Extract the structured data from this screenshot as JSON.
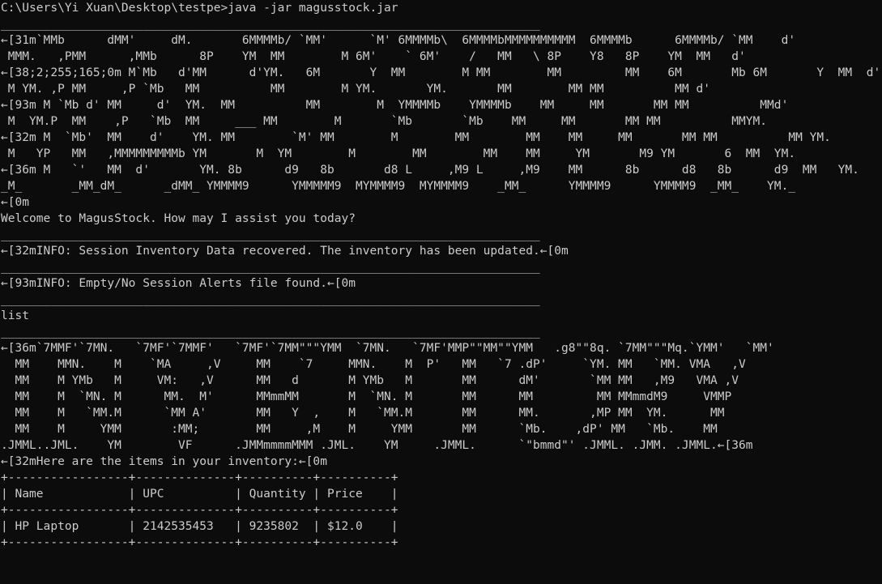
{
  "terminal": {
    "lines": [
      "C:\\Users\\Yi Xuan\\Desktop\\testpe>java -jar magusstock.jar",
      "____________________________________________________________________________",
      "←[31m`MMb      dMM'     dM.       6MMMMb/ `MM'      `M' 6MMMMb\\  6MMMMbMMMMMMMMMM  6MMMMb      6MMMMb/ `MM    d'",
      " MMM.   ,PMM      ,MMb      8P    YM  MM        M 6M'    ` 6M'    /   MM   \\ 8P    Y8   8P    YM  MM   d'",
      "←[38;2;255;165;0m M`Mb   d'MM      d'YM.   6M       Y  MM        M MM        MM         MM    6M       Mb 6M       Y  MM  d'",
      " M YM. ,P MM     ,P `Mb   MM          MM        M YM.       YM.       MM        MM MM          MM d'",
      "←[93m M `Mb d' MM     d'  YM.  MM          MM        M  YMMMMb    YMMMMb    MM     MM       MM MM          MMd'",
      " M  YM.P  MM    ,P   `Mb  MM     ___ MM        M       `Mb       `Mb    MM     MM       MM MM          MMYM.",
      "←[32m M  `Mb'  MM    d'    YM. MM        `M' MM        M        MM        MM    MM     MM       MM MM          MM YM.",
      " M   YP   MM   ,MMMMMMMMMb YM       M  YM        M        MM        MM    MM     YM       M9 YM       6  MM  YM.",
      "←[36m M   `'   MM  d'       YM. 8b      d9   8b       d8 L     ,M9 L     ,M9    MM      8b      d8   8b      d9  MM   YM.",
      "_M_       _MM_dM_      _dMM_ YMMMM9      YMMMMM9  MYMMMM9  MYMMMM9    _MM_      YMMMM9      YMMMM9  _MM_    YM._",
      "←[0m",
      "Welcome to MagusStock. How may I assist you today?",
      "____________________________________________________________________________",
      "←[32mINFO: Session Inventory Data recovered. The inventory has been updated.←[0m",
      "____________________________________________________________________________",
      "←[93mINFO: Empty/No Session Alerts file found.←[0m",
      "____________________________________________________________________________",
      "list",
      "____________________________________________________________________________",
      "←[36m`7MMF'`7MN.   `7MF'`7MMF'   `7MF'`7MM\"\"\"YMM  `7MN.   `7MF'MMP\"\"MM\"\"YMM   .g8\"\"8q. `7MM\"\"\"Mq.`YMM'   `MM'",
      "  MM    MMN.    M    `MA     ,V     MM    `7     MMN.    M  P'   MM   `7 .dP'     `YM. MM   `MM. VMA   ,V",
      "  MM    M YMb   M     VM:   ,V      MM   d       M YMb   M       MM      dM'       `MM MM   ,M9   VMA ,V",
      "  MM    M  `MN. M      MM.  M'      MMmmMM       M  `MN. M       MM      MM         MM MMmmdM9     VMMP",
      "  MM    M   `MM.M      `MM A'       MM   Y  ,    M   `MM.M       MM      MM.       ,MP MM  YM.      MM",
      "  MM    M     YMM       :MM;        MM     ,M    M     YMM       MM      `Mb.    ,dP' MM   `Mb.    MM",
      ".JMML..JML.    YM        VF      .JMMmmmmMMM .JML.    YM     .JMML.      `\"bmmd\"' .JMML. .JMM. .JMML.←[36m",
      "←[32mHere are the items in your inventory:←[0m",
      "+-----------------+--------------+----------+----------+",
      "| Name            | UPC          | Quantity | Price    |",
      "+-----------------+--------------+----------+----------+",
      "| HP Laptop       | 2142535453   | 9235802  | $12.0    |",
      "+-----------------+--------------+----------+----------+"
    ]
  }
}
